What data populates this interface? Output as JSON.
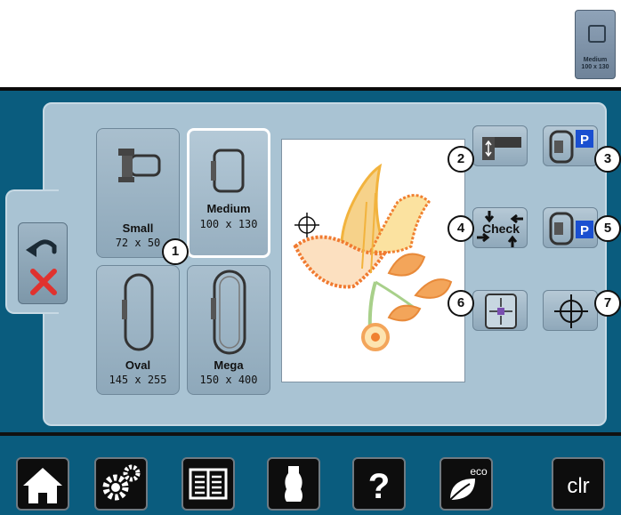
{
  "thumbnail": {
    "line1": "Medium",
    "line2": "100 x 130"
  },
  "hoops": [
    {
      "name": "Small",
      "size": "72 x 50",
      "selected": false
    },
    {
      "name": "Medium",
      "size": "100 x 130",
      "selected": true
    },
    {
      "name": "Oval",
      "size": "145 x 255",
      "selected": false
    },
    {
      "name": "Mega",
      "size": "150 x 400",
      "selected": false
    }
  ],
  "function_buttons": {
    "check_label": "Check",
    "park_label": "P"
  },
  "callouts": [
    "1",
    "2",
    "3",
    "4",
    "5",
    "6",
    "7"
  ],
  "toolbar": {
    "clr_label": "clr",
    "eco_label": "eco",
    "help_label": "?"
  },
  "icons": [
    "home-icon",
    "gears-icon",
    "book-icon",
    "dress-form-icon",
    "question-icon",
    "eco-leaf-icon",
    "clear-icon",
    "undo-icon",
    "cancel-x-icon",
    "crosshair-icon"
  ],
  "colors": {
    "screen_bg": "#0a5c7e",
    "panel_bg": "#a9c3d3",
    "cancel_red": "#e0322e",
    "park_blue": "#1a4fd0"
  }
}
